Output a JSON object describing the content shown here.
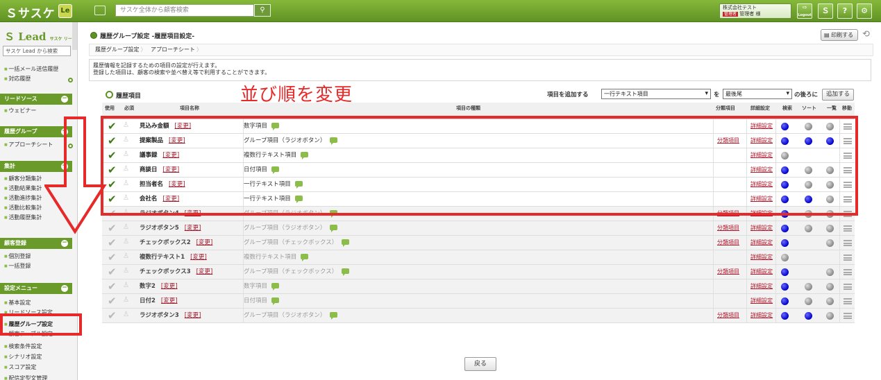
{
  "topbar": {
    "logo": "ＳサスケＮＡＳＫＥ",
    "le_label": "Le",
    "search_placeholder": "サスケ全体から顧客検索",
    "search_icon": "search-icon",
    "company": "株式会社テスト",
    "role_tag": "管理者",
    "user": "管理者 様",
    "buttons": [
      "logout",
      "sasuke",
      "help",
      "settings"
    ],
    "logout_label": "Logout"
  },
  "sidebar": {
    "logo": "Lead",
    "logo_sub": "サスケ リード",
    "search_placeholder": "サスケ Lead から検索",
    "top_items": [
      "一括メール送信履歴",
      "対応履歴"
    ],
    "sections": [
      {
        "title": "リードソース",
        "items": [
          "ウェビナー"
        ]
      },
      {
        "title": "履歴グループ",
        "items": [
          "アプローチシート"
        ]
      },
      {
        "title": "集計",
        "items": [
          "顧客分類集計",
          "活動結果集計",
          "活動進捗集計",
          "活動比較集計",
          "活動履歴集計"
        ]
      },
      {
        "title": "顧客登録",
        "items": [
          "個別登録",
          "一括登録"
        ]
      },
      {
        "title": "設定メニュー",
        "items": [
          "基本設定",
          "リードソース設定",
          "履歴グループ設定",
          "顧客テーブル設定",
          "検索条件設定",
          "シナリオ設定",
          "スコア設定",
          "配信定型文管理"
        ]
      }
    ]
  },
  "page": {
    "title": "履歴グループ設定 -履歴項目設定-",
    "print_label": "印刷する",
    "breadcrumb": [
      "履歴グループ設定",
      "アプローチシート"
    ],
    "info_line1": "履歴情報を記録するための項目の設定が行えます。",
    "info_line2": "登録した項目は、顧客の検索や並べ替え等で利用することができます。",
    "section_title": "履歴項目",
    "annotation": "並び順を変更",
    "add_label": "項目を追加する",
    "add_type": "一行テキスト項目",
    "wo": "を",
    "position": "最後尾",
    "after_label": "の後ろに",
    "add_button": "追加する",
    "back_button": "戻る"
  },
  "table": {
    "headers": {
      "use": "使用",
      "required": "必須",
      "name": "項目名称",
      "type": "項目の種類",
      "class": "分類項目",
      "detail": "詳細設定",
      "search": "検索",
      "sort": "ソート",
      "list": "一覧",
      "move": "移動"
    },
    "change_label": "[変更]",
    "class_link": "分類項目",
    "detail_link": "詳細設定",
    "rows": [
      {
        "name": "見込み金額",
        "type": "数字項目",
        "active": true,
        "has_class": false,
        "search": "blue",
        "sort": "gray",
        "list": "gray"
      },
      {
        "name": "提案製品",
        "type": "グループ項目（ラジオボタン）",
        "active": true,
        "has_class": true,
        "search": "blue",
        "sort": "blue",
        "list": "blue"
      },
      {
        "name": "議事録",
        "type": "複数行テキスト項目",
        "active": true,
        "has_class": false,
        "search": "gray",
        "sort": "",
        "list": ""
      },
      {
        "name": "商談日",
        "type": "日付項目",
        "active": true,
        "has_class": false,
        "search": "blue",
        "sort": "gray",
        "list": "gray"
      },
      {
        "name": "担当者名",
        "type": "一行テキスト項目",
        "active": true,
        "has_class": false,
        "search": "blue",
        "sort": "gray",
        "list": "gray"
      },
      {
        "name": "会社名",
        "type": "一行テキスト項目",
        "active": true,
        "has_class": false,
        "search": "blue",
        "sort": "blue",
        "list": "gray"
      },
      {
        "name": "ラジオボタン4",
        "type": "グループ項目（ラジオボタン）",
        "active": false,
        "has_class": true,
        "search": "blue",
        "sort": "gray",
        "list": "gray"
      },
      {
        "name": "ラジオボタン5",
        "type": "グループ項目（ラジオボタン）",
        "active": false,
        "has_class": true,
        "search": "blue",
        "sort": "gray",
        "list": "gray"
      },
      {
        "name": "チェックボックス2",
        "type": "グループ項目（チェックボックス）",
        "active": false,
        "has_class": true,
        "search": "blue",
        "sort": "",
        "list": "gray"
      },
      {
        "name": "複数行テキスト1",
        "type": "複数行テキスト項目",
        "active": false,
        "has_class": false,
        "search": "gray",
        "sort": "",
        "list": ""
      },
      {
        "name": "チェックボックス3",
        "type": "グループ項目（チェックボックス）",
        "active": false,
        "has_class": true,
        "search": "blue",
        "sort": "",
        "list": "gray"
      },
      {
        "name": "数字2",
        "type": "数字項目",
        "active": false,
        "has_class": false,
        "search": "blue",
        "sort": "gray",
        "list": "gray"
      },
      {
        "name": "日付2",
        "type": "日付項目",
        "active": false,
        "has_class": false,
        "search": "blue",
        "sort": "gray",
        "list": "gray"
      },
      {
        "name": "ラジオボタン3",
        "type": "グループ項目（ラジオボタン）",
        "active": false,
        "has_class": true,
        "search": "blue",
        "sort": "blue",
        "list": "gray"
      }
    ]
  },
  "colors": {
    "brand": "#6a9a2a",
    "annotation": "#e62a2a",
    "link": "#b0172a",
    "blue_dot": "#0000c8",
    "gray_dot": "#888888"
  }
}
